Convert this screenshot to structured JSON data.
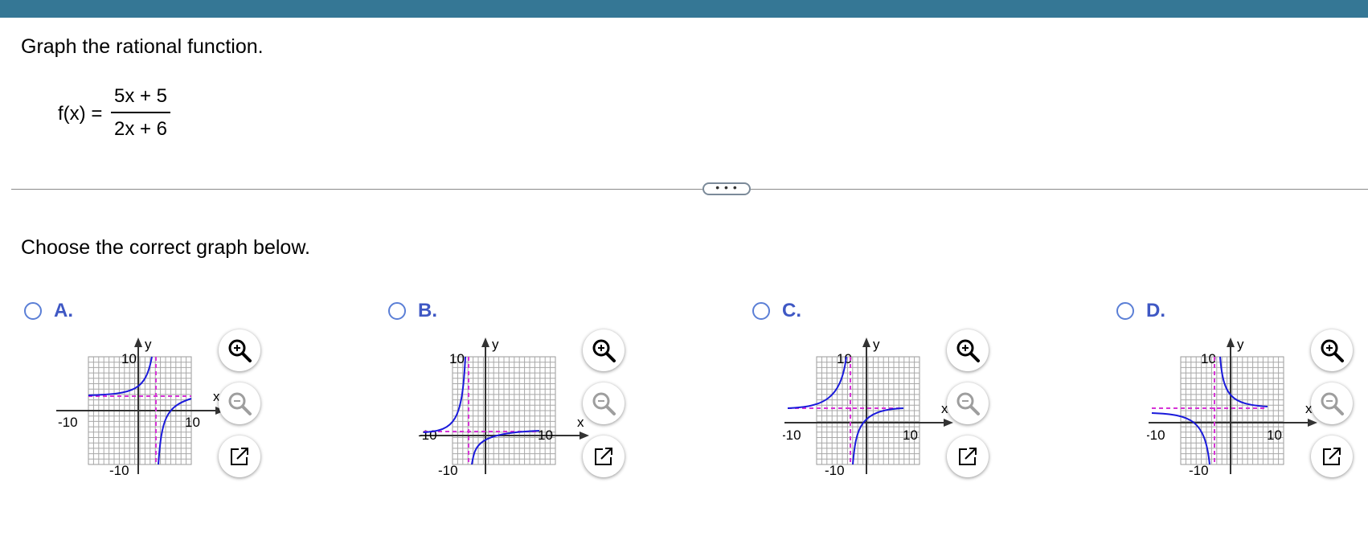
{
  "question": {
    "prompt": "Graph the rational function.",
    "function_label": "f(x) =",
    "numerator": "5x + 5",
    "denominator": "2x + 6"
  },
  "expander_label": "• • •",
  "instruction": "Choose the correct graph below.",
  "options": [
    {
      "letter": "A.",
      "selected": false
    },
    {
      "letter": "B.",
      "selected": false
    },
    {
      "letter": "C.",
      "selected": false
    },
    {
      "letter": "D.",
      "selected": false
    }
  ],
  "graph_labels": {
    "y": "y",
    "x": "x",
    "max": "10",
    "min": "-10"
  },
  "colors": {
    "curve": "#1a1adb",
    "asymptote": "#d633d6",
    "grid": "#9a9a9a",
    "axis": "#333333",
    "accent": "#3f58c4",
    "header": "#357795"
  },
  "tools": [
    "zoom-in-icon",
    "zoom-out-icon",
    "open-new-window-icon"
  ]
}
